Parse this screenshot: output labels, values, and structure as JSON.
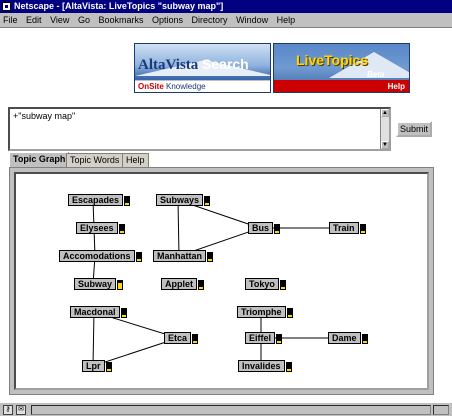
{
  "window": {
    "title": "Netscape - [AltaVista: LiveTopics \"subway map\"]"
  },
  "menu": [
    {
      "label": "File"
    },
    {
      "label": "Edit"
    },
    {
      "label": "View"
    },
    {
      "label": "Go"
    },
    {
      "label": "Bookmarks"
    },
    {
      "label": "Options"
    },
    {
      "label": "Directory"
    },
    {
      "label": "Window"
    },
    {
      "label": "Help"
    }
  ],
  "banner": {
    "logo_alt": "AltaVista",
    "logo_search": "Search",
    "onsite": "OnSite",
    "knowledge": "Knowledge",
    "livetopics": "LiveTopics",
    "beta": "Beta",
    "help": "Help"
  },
  "query": {
    "value": "+\"subway map\""
  },
  "submit_label": "Submit",
  "tabs": [
    {
      "label": "Topic Graph",
      "active": true
    },
    {
      "label": "Topic Words",
      "active": false
    },
    {
      "label": "Help",
      "active": false
    }
  ],
  "graph": {
    "nodes": [
      {
        "id": "escapades",
        "label": "Escapades"
      },
      {
        "id": "elysees",
        "label": "Elysees"
      },
      {
        "id": "accomodations",
        "label": "Accomodations"
      },
      {
        "id": "subway",
        "label": "Subway"
      },
      {
        "id": "subways",
        "label": "Subways"
      },
      {
        "id": "manhattan",
        "label": "Manhattan"
      },
      {
        "id": "bus",
        "label": "Bus"
      },
      {
        "id": "train",
        "label": "Train"
      },
      {
        "id": "applet",
        "label": "Applet"
      },
      {
        "id": "tokyo",
        "label": "Tokyo"
      },
      {
        "id": "macdonal",
        "label": "Macdonal"
      },
      {
        "id": "etca",
        "label": "Etca"
      },
      {
        "id": "lpr",
        "label": "Lpr"
      },
      {
        "id": "triomphe",
        "label": "Triomphe"
      },
      {
        "id": "eiffel",
        "label": "Eiffel"
      },
      {
        "id": "dame",
        "label": "Dame"
      },
      {
        "id": "invalides",
        "label": "Invalides"
      }
    ],
    "edges": [
      [
        "escapades",
        "elysees"
      ],
      [
        "elysees",
        "accomodations"
      ],
      [
        "accomodations",
        "subway"
      ],
      [
        "subways",
        "manhattan"
      ],
      [
        "subways",
        "bus"
      ],
      [
        "manhattan",
        "bus"
      ],
      [
        "bus",
        "train"
      ],
      [
        "macdonal",
        "etca"
      ],
      [
        "macdonal",
        "lpr"
      ],
      [
        "etca",
        "lpr"
      ],
      [
        "triomphe",
        "eiffel"
      ],
      [
        "eiffel",
        "dame"
      ],
      [
        "eiffel",
        "invalides"
      ]
    ]
  }
}
